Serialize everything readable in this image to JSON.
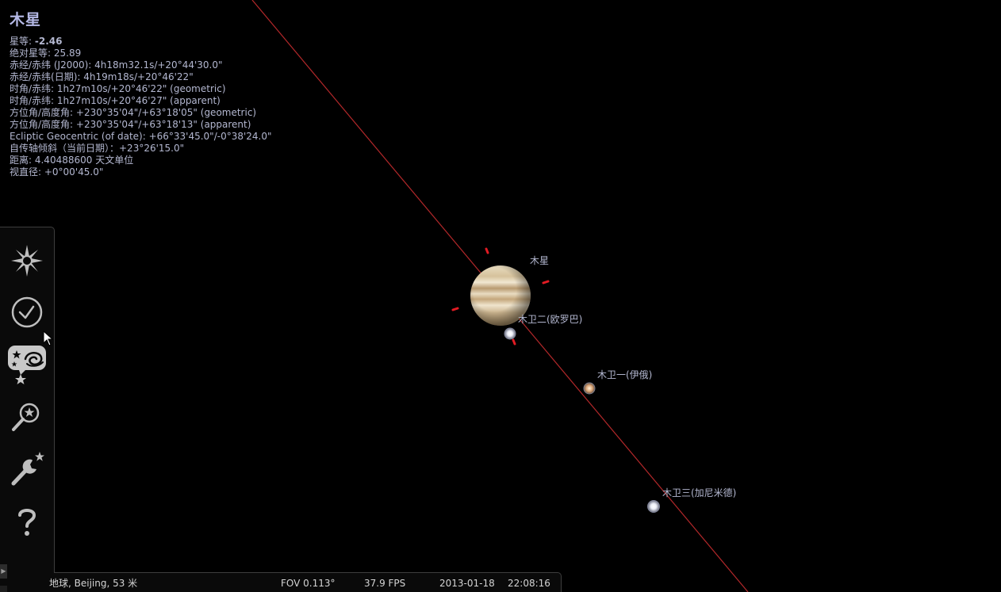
{
  "object": {
    "title": "木星",
    "magnitude_label": "星等:",
    "magnitude_value": "-2.46",
    "lines": [
      "绝对星等: 25.89",
      "赤经/赤纬 (J2000): 4h18m32.1s/+20°44'30.0\"",
      "赤经/赤纬(日期): 4h19m18s/+20°46'22\"",
      "时角/赤纬: 1h27m10s/+20°46'22\" (geometric)",
      "时角/赤纬: 1h27m10s/+20°46'27\" (apparent)",
      "方位角/高度角: +230°35'04\"/+63°18'05\" (geometric)",
      "方位角/高度角: +230°35'04\"/+63°18'13\" (apparent)",
      "Ecliptic Geocentric (of date): +66°33'45.0\"/-0°38'24.0\"",
      "自传轴倾斜（当前日期）：+23°26'15.0\"",
      "距离: 4.40488600 天文单位",
      "视直径: +0°00'45.0\""
    ]
  },
  "sky_labels": {
    "jupiter": "木星",
    "europa": "木卫二(欧罗巴)",
    "io": "木卫一(伊俄)",
    "ganymede": "木卫三(加尼米德)"
  },
  "status_bar": {
    "location": "地球, Beijing, 53 米",
    "fov": "FOV 0.113°",
    "fps": "37.9 FPS",
    "date": "2013-01-18",
    "time": "22:08:16"
  },
  "colors": {
    "ecliptic_line": "#b3282a",
    "selection_marker": "#e21b23",
    "label_text": "#b3b7d0",
    "icon": "#bebebe"
  },
  "sidebar": {
    "icons": [
      "sky-display-icon",
      "clock-icon",
      "sky-objects-icon",
      "search-icon",
      "settings-icon",
      "help-icon"
    ]
  }
}
